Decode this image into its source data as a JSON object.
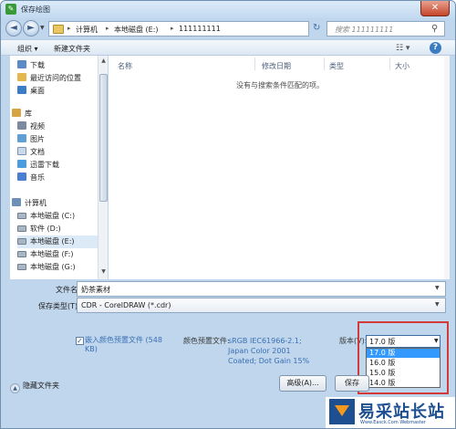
{
  "window": {
    "title": "保存绘图",
    "close_glyph": "✕"
  },
  "address": {
    "back_glyph": "◄",
    "forward_glyph": "►",
    "breadcrumbs": [
      "计算机",
      "本地磁盘 (E:)",
      "111111111"
    ],
    "search_placeholder": "搜索 111111111",
    "refresh_glyph": "↻"
  },
  "toolbar": {
    "organize": "组织 ▾",
    "new_folder": "新建文件夹",
    "help_glyph": "?"
  },
  "nav": {
    "items": [
      {
        "label": "下载",
        "icon": "download-icon"
      },
      {
        "label": "最近访问的位置",
        "icon": "recent-places-icon"
      },
      {
        "label": "桌面",
        "icon": "desktop-icon"
      },
      {
        "label": "库",
        "icon": "library-icon"
      },
      {
        "label": "视频",
        "icon": "video-icon"
      },
      {
        "label": "图片",
        "icon": "picture-icon"
      },
      {
        "label": "文档",
        "icon": "document-icon"
      },
      {
        "label": "迅雷下载",
        "icon": "xunlei-icon"
      },
      {
        "label": "音乐",
        "icon": "music-icon"
      },
      {
        "label": "计算机",
        "icon": "computer-icon"
      },
      {
        "label": "本地磁盘 (C:)",
        "icon": "drive-icon"
      },
      {
        "label": "软件 (D:)",
        "icon": "drive-icon"
      },
      {
        "label": "本地磁盘 (E:)",
        "icon": "drive-icon",
        "selected": true
      },
      {
        "label": "本地磁盘 (F:)",
        "icon": "drive-icon"
      },
      {
        "label": "本地磁盘 (G:)",
        "icon": "drive-icon"
      }
    ]
  },
  "files": {
    "columns": [
      "名称",
      "修改日期",
      "类型",
      "大小"
    ],
    "empty_message": "没有与搜索条件匹配的项。"
  },
  "form": {
    "filename_label": "文件名(N):",
    "filename_value": "奶茶素材",
    "savetype_label": "保存类型(T):",
    "savetype_value": "CDR - CorelDRAW (*.cdr)",
    "embed_checked": true,
    "embed_label": "嵌入颜色预置文件 (548 KB)",
    "preset_label": "颜色预置文件:",
    "preset_value": "sRGB IEC61966-2.1; Japan Color 2001 Coated; Dot Gain 15%",
    "version_label": "版本(V):",
    "version_value": "17.0 版",
    "version_options": [
      "17.0 版",
      "16.0 版",
      "15.0 版",
      "14.0 版"
    ],
    "version_selected_index": 0
  },
  "footer": {
    "hide_folders": "隐藏文件夹",
    "advanced_button": "高级(A)...",
    "save_button": "保存"
  },
  "watermark": {
    "text": "易采站长站",
    "sub": "Www.Easck.Com Webmaster"
  },
  "colors": {
    "selection_blue": "#3399ff",
    "highlight_red": "#d23a3a",
    "link_blue": "#3b6fb5"
  }
}
